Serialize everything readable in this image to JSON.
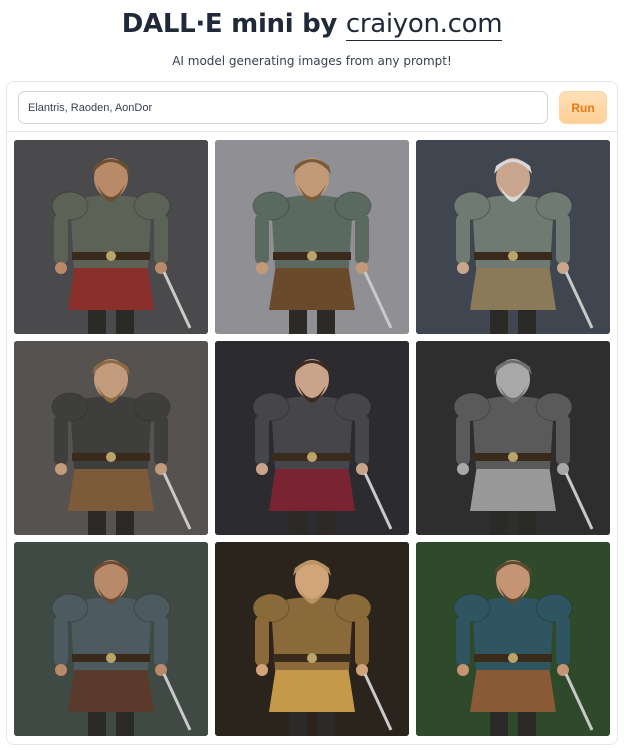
{
  "header": {
    "title_prefix": "DALL·E mini by ",
    "title_domain": "craiyon.com",
    "subtitle": "AI model generating images from any prompt!"
  },
  "prompt": {
    "value": "Elantris, Raoden, AonDor",
    "run_label": "Run"
  },
  "colors": {
    "run_text": "#ea7a14",
    "run_bg": "#ffd6a5"
  },
  "images": [
    {
      "name": "generated-image-1",
      "bg": "#4a4a4c",
      "armor": "#5d6257",
      "accent": "#8a2f2a",
      "skin": "#b98a68",
      "hair": "#6b4f33"
    },
    {
      "name": "generated-image-2",
      "bg": "#8f8f94",
      "armor": "#5b6a61",
      "accent": "#6b4a2c",
      "skin": "#c39a78",
      "hair": "#7a5a3a"
    },
    {
      "name": "generated-image-3",
      "bg": "#3f4650",
      "armor": "#6f7a72",
      "accent": "#8a7a58",
      "skin": "#c8a58c",
      "hair": "#d8d8d8"
    },
    {
      "name": "generated-image-4",
      "bg": "#55524f",
      "armor": "#3e3f3d",
      "accent": "#7d5a3a",
      "skin": "#c29a7c",
      "hair": "#8a6a42"
    },
    {
      "name": "generated-image-5",
      "bg": "#2c2c30",
      "armor": "#45454a",
      "accent": "#7a2433",
      "skin": "#c9a48a",
      "hair": "#3a2c22"
    },
    {
      "name": "generated-image-6",
      "bg": "#2e2e2e",
      "armor": "#5a5a5a",
      "accent": "#999999",
      "skin": "#a8a8a8",
      "hair": "#6f6f6f"
    },
    {
      "name": "generated-image-7",
      "bg": "#3f4a44",
      "armor": "#4d5a5f",
      "accent": "#5a3a2a",
      "skin": "#b88a6a",
      "hair": "#6a4a32"
    },
    {
      "name": "generated-image-8",
      "bg": "#2a241c",
      "armor": "#8a6a3a",
      "accent": "#c49a4a",
      "skin": "#d1a47a",
      "hair": "#b89462"
    },
    {
      "name": "generated-image-9",
      "bg": "#2f4a2a",
      "armor": "#2f5560",
      "accent": "#8a5a36",
      "skin": "#c59474",
      "hair": "#5a4a32"
    }
  ]
}
